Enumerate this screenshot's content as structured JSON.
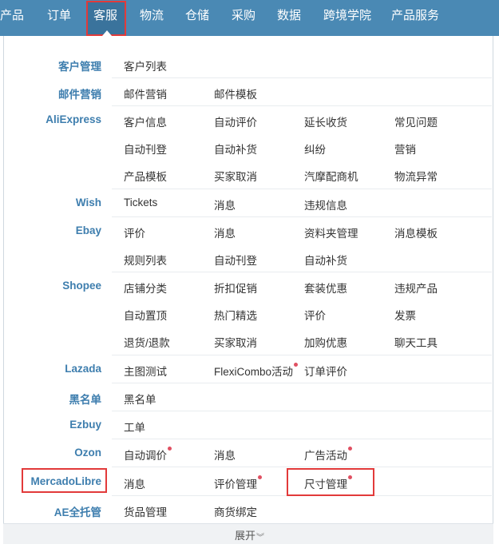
{
  "nav": {
    "items": [
      "产品",
      "订单",
      "客服",
      "物流",
      "仓储",
      "采购",
      "数据",
      "跨境学院",
      "产品服务"
    ],
    "active": "客服"
  },
  "menu": [
    {
      "category": "客户管理",
      "rows": [
        [
          "客户列表"
        ]
      ]
    },
    {
      "category": "邮件营销",
      "rows": [
        [
          "邮件营销",
          "邮件模板"
        ]
      ]
    },
    {
      "category": "AliExpress",
      "rows": [
        [
          "客户信息",
          "自动评价",
          "延长收货",
          "常见问题"
        ],
        [
          "自动刊登",
          "自动补货",
          "纠纷",
          "营销"
        ],
        [
          "产品模板",
          "买家取消",
          "汽摩配商机",
          "物流异常"
        ]
      ]
    },
    {
      "category": "Wish",
      "rows": [
        [
          "Tickets",
          "消息",
          "违规信息"
        ]
      ]
    },
    {
      "category": "Ebay",
      "rows": [
        [
          "评价",
          "消息",
          "资料夹管理",
          "消息模板"
        ],
        [
          "规则列表",
          "自动刊登",
          "自动补货"
        ]
      ]
    },
    {
      "category": "Shopee",
      "rows": [
        [
          "店铺分类",
          "折扣促销",
          "套装优惠",
          "违规产品"
        ],
        [
          "自动置顶",
          "热门精选",
          "评价",
          "发票"
        ],
        [
          "退货/退款",
          "买家取消",
          "加购优惠",
          "聊天工具"
        ]
      ]
    },
    {
      "category": "Lazada",
      "rows": [
        [
          "主图测试",
          "FlexiCombo活动",
          "订单评价"
        ]
      ]
    },
    {
      "category": "黑名单",
      "rows": [
        [
          "黑名单"
        ]
      ]
    },
    {
      "category": "Ezbuy",
      "rows": [
        [
          "工单"
        ]
      ]
    },
    {
      "category": "Ozon",
      "rows": [
        [
          "自动调价",
          "消息",
          "广告活动"
        ]
      ]
    },
    {
      "category": "MercadoLibre",
      "rows": [
        [
          "消息",
          "评价管理",
          "尺寸管理"
        ]
      ]
    },
    {
      "category": "AE全托管",
      "rows": [
        [
          "货品管理",
          "商货绑定"
        ]
      ]
    }
  ],
  "footer": {
    "expand_label": "展开"
  },
  "colors": {
    "nav_bg": "#4a89b4",
    "nav_active_bg": "#3a739c",
    "category_text": "#3e7eae",
    "highlight_border": "#e23a3a",
    "new_dot": "#e05062"
  }
}
